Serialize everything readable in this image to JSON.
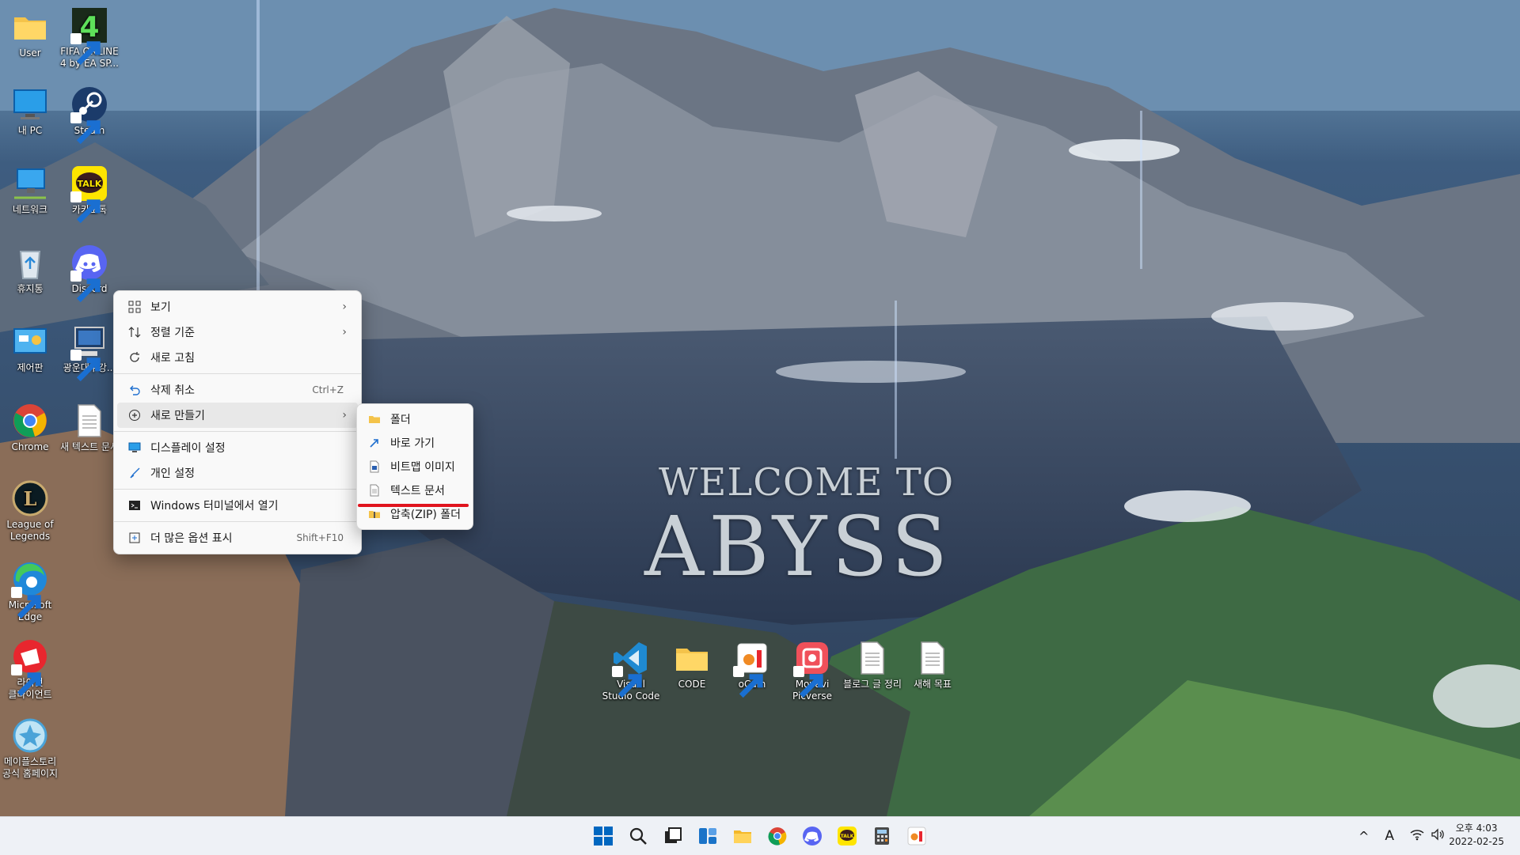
{
  "desktop": {
    "wallpaper_line1": "WELCOME TO",
    "wallpaper_line2": "ABYSS",
    "icons": [
      {
        "label": "User"
      },
      {
        "label": "FIFA ONLINE 4 by EA SP..."
      },
      {
        "label": "내 PC"
      },
      {
        "label": "Steam"
      },
      {
        "label": "네트워크"
      },
      {
        "label": "카카오톡"
      },
      {
        "label": "휴지통"
      },
      {
        "label": "Discord"
      },
      {
        "label": "제어판"
      },
      {
        "label": "광운대수강..."
      },
      {
        "label": "Chrome"
      },
      {
        "label": "새 텍스트 문서"
      },
      {
        "label": "League of Legends"
      },
      {
        "label": "Microsoft Edge"
      },
      {
        "label": "라이엇 클라이언트"
      },
      {
        "label": "메이플스토리 공식 홈페이지"
      },
      {
        "label": "Visual Studio Code"
      },
      {
        "label": "CODE"
      },
      {
        "label": "oCam"
      },
      {
        "label": "Movavi Picverse"
      },
      {
        "label": "블로그 글 정리"
      },
      {
        "label": "새해 목표"
      }
    ]
  },
  "context_menu": {
    "items": [
      {
        "label": "보기",
        "icon": "grid-icon",
        "submenu": true
      },
      {
        "label": "정렬 기준",
        "icon": "sort-icon",
        "submenu": true
      },
      {
        "label": "새로 고침",
        "icon": "refresh-icon"
      },
      {
        "label": "삭제 취소",
        "icon": "undo-icon",
        "shortcut": "Ctrl+Z"
      },
      {
        "label": "새로 만들기",
        "icon": "plus-icon",
        "submenu": true,
        "highlighted": true
      },
      {
        "label": "디스플레이 설정",
        "icon": "display-icon"
      },
      {
        "label": "개인 설정",
        "icon": "brush-icon"
      },
      {
        "label": "Windows 터미널에서 열기",
        "icon": "terminal-icon"
      },
      {
        "label": "더 많은 옵션 표시",
        "icon": "more-options-icon",
        "shortcut": "Shift+F10"
      }
    ]
  },
  "new_submenu": {
    "items": [
      {
        "label": "폴더",
        "icon": "folder-icon"
      },
      {
        "label": "바로 가기",
        "icon": "shortcut-icon"
      },
      {
        "label": "비트맵 이미지",
        "icon": "bitmap-icon"
      },
      {
        "label": "텍스트 문서",
        "icon": "text-document-icon",
        "underlined": true
      },
      {
        "label": "압축(ZIP) 폴더",
        "icon": "zip-folder-icon"
      }
    ]
  },
  "taskbar": {
    "apps": [
      "start-icon",
      "search-icon",
      "task-view-icon",
      "widgets-icon",
      "file-explorer-icon",
      "chrome-icon",
      "discord-icon",
      "kakaotalk-icon",
      "calculator-icon",
      "ocam-icon"
    ],
    "tray": {
      "chevron": "^",
      "ime": "A",
      "time": "오후 4:03",
      "date": "2022-02-25"
    }
  },
  "colors": {
    "taskbar_bg": "#eef1f6",
    "menu_bg": "#f9f9f9",
    "underline": "#e0141e",
    "accent": "#0067c0"
  }
}
